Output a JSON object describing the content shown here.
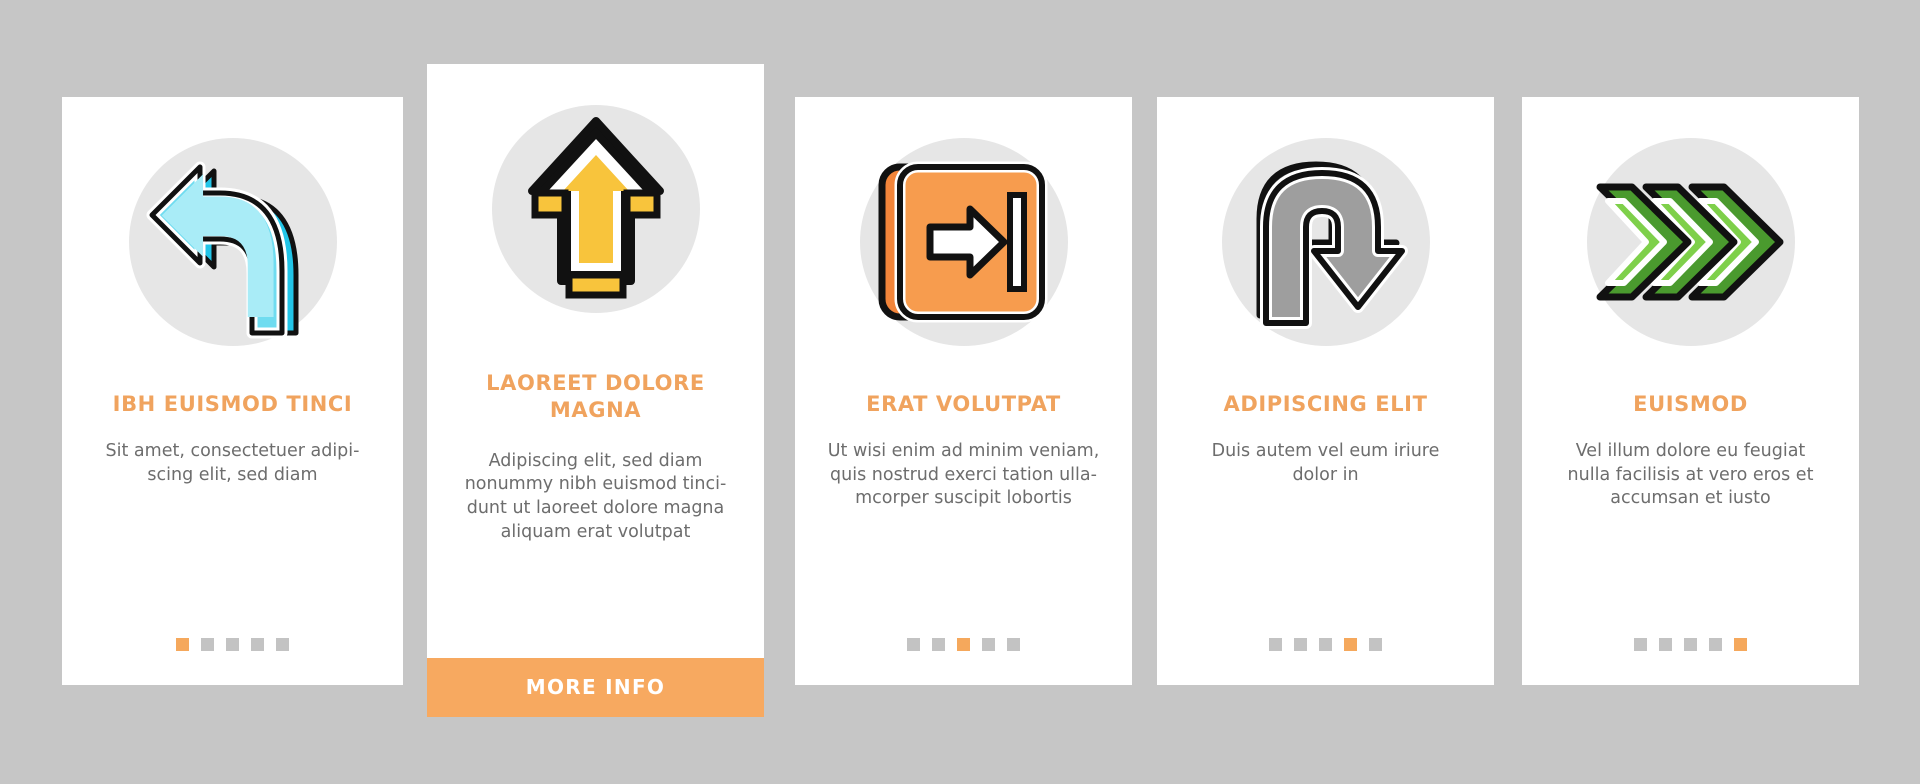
{
  "page": {
    "background_color": "#c6c6c6",
    "card_background": "#ffffff",
    "accent_color": "#f0a35e",
    "body_text_color": "#6d6d6d",
    "dot_inactive_color": "#c3c3c3",
    "dot_active_color": "#f5a85c",
    "icon_disc_color": "#e6e6e6"
  },
  "cards": [
    {
      "icon_name": "turn-left-arrow-icon",
      "icon_colors": {
        "primary": "#6fdcf0",
        "secondary": "#22c5e8",
        "outline": "#111111",
        "inner": "#ffffff"
      },
      "title": "IBH EUISMOD TINCI",
      "body": "Sit amet, consectetuer adipi-\nscing elit, sed diam",
      "dots": {
        "count": 5,
        "active_index": 0
      },
      "has_button": false
    },
    {
      "icon_name": "up-arrow-icon",
      "icon_colors": {
        "primary": "#f8c43c",
        "secondary": "#f5b424",
        "outline": "#111111",
        "inner": "#ffffff"
      },
      "title": "LAOREET DOLORE MAGNA",
      "body": "Adipiscing elit, sed diam\nnonummy nibh euismod tinci-\ndunt ut laoreet dolore magna\naliquam erat volutpat",
      "dots": null,
      "has_button": true,
      "button_label": "MORE INFO"
    },
    {
      "icon_name": "exit-door-arrow-icon",
      "icon_colors": {
        "primary": "#f79c4e",
        "secondary": "#f3853a",
        "outline": "#111111",
        "inner": "#ffffff"
      },
      "title": "ERAT VOLUTPAT",
      "body": "Ut wisi enim ad minim veniam,\nquis nostrud exerci tation ulla-\nmcorper suscipit lobortis",
      "dots": {
        "count": 5,
        "active_index": 2
      },
      "has_button": false
    },
    {
      "icon_name": "u-turn-down-arrow-icon",
      "icon_colors": {
        "primary": "#9e9e9e",
        "secondary": "#5c5c5c",
        "outline": "#111111",
        "inner": "#ffffff"
      },
      "title": "ADIPISCING ELIT",
      "body": "Duis autem vel eum iriure\ndolor in",
      "dots": {
        "count": 5,
        "active_index": 3
      },
      "has_button": false
    },
    {
      "icon_name": "triple-chevron-right-icon",
      "icon_colors": {
        "primary": "#7ed04a",
        "secondary": "#4a9a2e",
        "outline": "#111111",
        "inner": "#ffffff"
      },
      "title": "EUISMOD",
      "body": "Vel illum dolore eu feugiat\nnulla facilisis at vero eros et\naccumsan et iusto",
      "dots": {
        "count": 5,
        "active_index": 4
      },
      "has_button": false
    }
  ]
}
